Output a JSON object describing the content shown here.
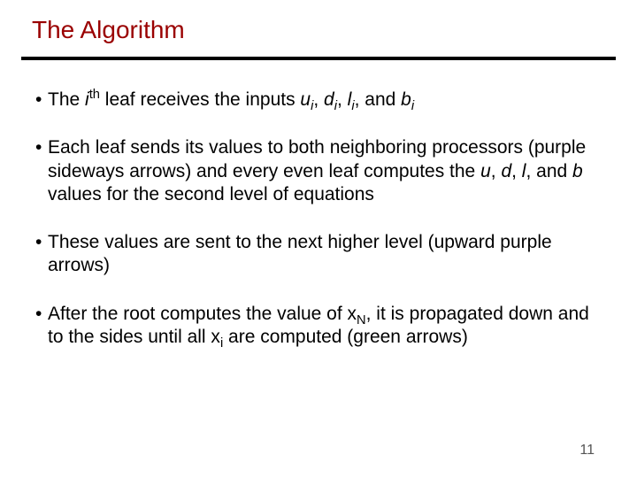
{
  "title": "The Algorithm",
  "bullets": {
    "b1": {
      "pre": "The ",
      "i_var": "i",
      "th": "th",
      "mid": " leaf receives the inputs ",
      "u": "u",
      "u_sub": "i",
      "d": "d",
      "d_sub": "i",
      "l": "l",
      "l_sub": "i",
      "and": ", and ",
      "b": "b",
      "b_sub": "i",
      "c1": ", ",
      "c2": ", "
    },
    "b2": {
      "part1": "Each leaf sends its values to both neighboring processors (purple sideways arrows) and every even leaf computes the ",
      "u": "u",
      "c1": ", ",
      "d": "d",
      "c2": ", ",
      "l": "l",
      "c3": ", and ",
      "b": "b",
      "part2": " values for the second level of equations"
    },
    "b3": "These values are sent to the next higher level (upward purple arrows)",
    "b4": {
      "part1": "After the root computes the value of x",
      "sub1": "N",
      "part2": ", it is propagated down and to the sides until all x",
      "sub2": "i",
      "part3": " are computed (green arrows)"
    }
  },
  "page_number": "11"
}
